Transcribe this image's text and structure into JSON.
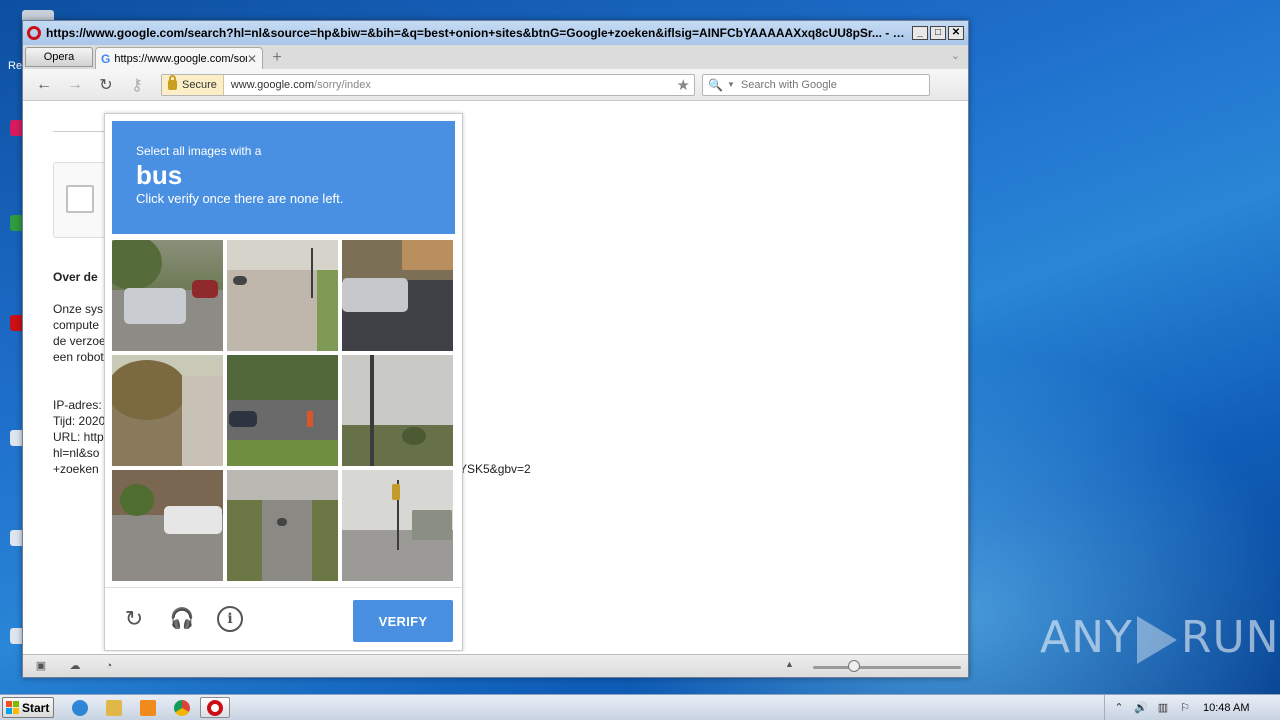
{
  "window": {
    "title": "https://www.google.com/search?hl=nl&source=hp&biw=&bih=&q=best+onion+sites&btnG=Google+zoeken&iflsig=AINFCbYAAAAAXxq8cUU8pSr... - Opera",
    "min_label": "_",
    "max_label": "□",
    "close_label": "✕"
  },
  "tabs": {
    "menu_label": "Opera",
    "active_tab_title": "https://www.google.com/sorry/index",
    "tab_close": "✕",
    "new_tab": "+",
    "list_chevron": "⌄"
  },
  "toolbar": {
    "back": "←",
    "forward": "→",
    "reload": "↻",
    "key": "⚷",
    "secure_label": "Secure",
    "url_host": "www.google.com",
    "url_path": "/sorry/index",
    "star": "★",
    "search_placeholder": "Search with Google",
    "search_icon": "🔍",
    "search_caret": "▼"
  },
  "page": {
    "over_heading": "Over de",
    "body_lines": [
      "Onze sys",
      "compute",
      "de verzoe",
      "een robot"
    ],
    "ip_line": "IP-adres:",
    "time_line": "Tijd: 2020",
    "url_line": "URL: http",
    "url_line2": "hl=nl&so",
    "url_line3": "+zoeken",
    "url_tail": "YSK5&gbv=2"
  },
  "captcha": {
    "subtitle": "Select all images with a",
    "object": "bus",
    "instruction": "Click verify once there are none left.",
    "verify_label": "VERIFY",
    "reload_icon": "↻",
    "audio_icon": "🎧",
    "info_icon": "i"
  },
  "statusbar": {
    "panel_icon": "▣",
    "cloud_icon": "☁",
    "speed_icon": "◔",
    "zoom_arrow": "▲"
  },
  "taskbar": {
    "start_label": "Start",
    "clock": "10:48 AM",
    "tray_up": "⌃",
    "volume_icon": "🔊",
    "flag_icon": "⚐"
  },
  "watermark": {
    "left": "ANY",
    "right": "RUN"
  },
  "colors": {
    "captcha_blue": "#4a90e2",
    "opera_red": "#cc0f16",
    "desktop_blue": "#1e6fcc"
  }
}
